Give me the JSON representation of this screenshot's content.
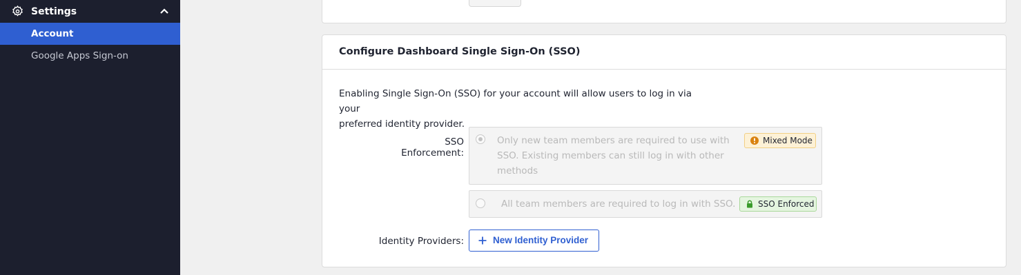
{
  "sidebar": {
    "section_title": "Settings",
    "section_icon": "gear-icon",
    "collapse_icon": "chevron-up-icon",
    "items": [
      {
        "label": "Account",
        "active": true
      },
      {
        "label": "Google Apps Sign-on",
        "active": false
      }
    ]
  },
  "sso_card": {
    "title": "Configure Dashboard Single Sign-On (SSO)",
    "intro_line1": "Enabling Single Sign-On (SSO) for your account will allow users to log in via your",
    "intro_line2": "preferred identity provider.",
    "enforcement_label": "SSO Enforcement:",
    "options": [
      {
        "text": "Only new team members are required to use with SSO. Existing members can still log in with other methods",
        "badge": "Mixed Mode",
        "badge_icon": "warning-icon",
        "selected": true
      },
      {
        "text": "All team members are required to log in with SSO.",
        "badge": "SSO Enforced",
        "badge_icon": "lock-icon",
        "selected": false
      }
    ],
    "providers_label": "Identity Providers:",
    "new_provider_button": "New Identity Provider"
  },
  "colors": {
    "sidebar_bg": "#1c1f2e",
    "accent": "#2f5fd1",
    "mixed_badge_bg": "#fdf1d6",
    "enforced_badge_bg": "#e5f5e0"
  }
}
